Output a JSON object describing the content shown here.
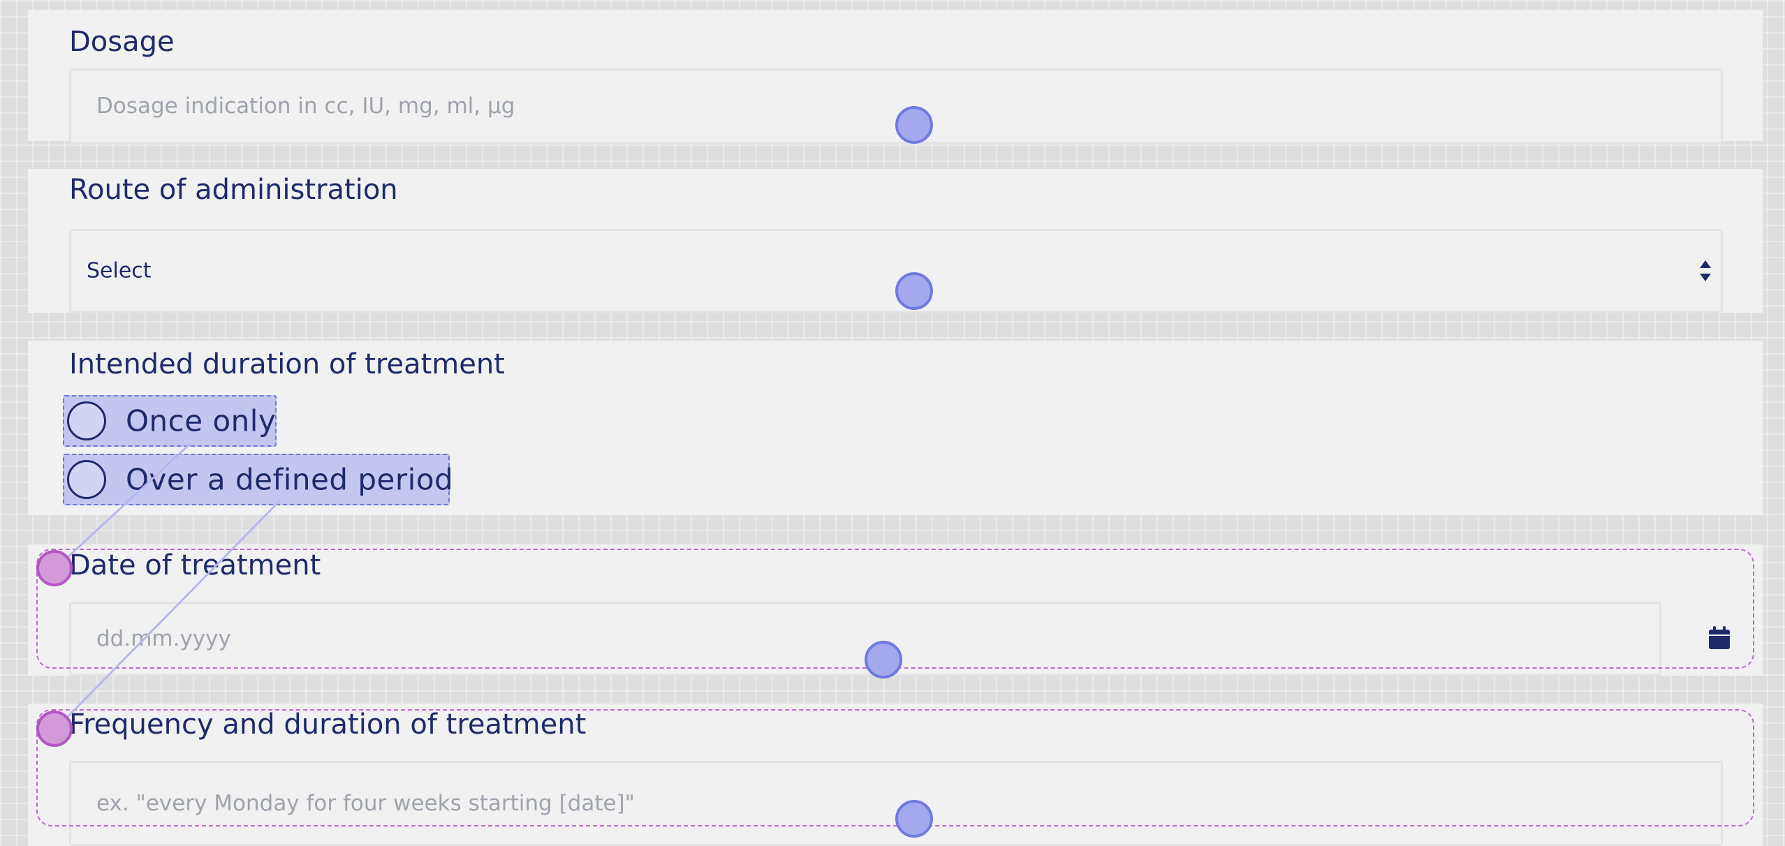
{
  "form": {
    "dosage": {
      "label": "Dosage",
      "placeholder": "Dosage indication in cc, IU, mg, ml, µg"
    },
    "route": {
      "label": "Route of administration",
      "selected": "Select"
    },
    "duration": {
      "label": "Intended duration of treatment",
      "options": [
        {
          "label": "Once only"
        },
        {
          "label": "Over a defined period"
        }
      ]
    },
    "date": {
      "label": "Date of treatment",
      "placeholder": "dd.mm.yyyy",
      "icon": "calendar-icon"
    },
    "frequency": {
      "label": "Frequency and duration of treatment",
      "placeholder": "ex. \"every Monday for four weeks starting [date]\""
    }
  },
  "colors": {
    "text": "#1f2a6b",
    "placeholder": "#9ea3ad",
    "panel": "#f1f1f1",
    "handle": "#a4a9ee",
    "handle_border": "#6f7ae0",
    "logic_handle": "#d39ad8",
    "logic_border": "#bf69d0",
    "radio_highlight": "#c5c6ef"
  }
}
